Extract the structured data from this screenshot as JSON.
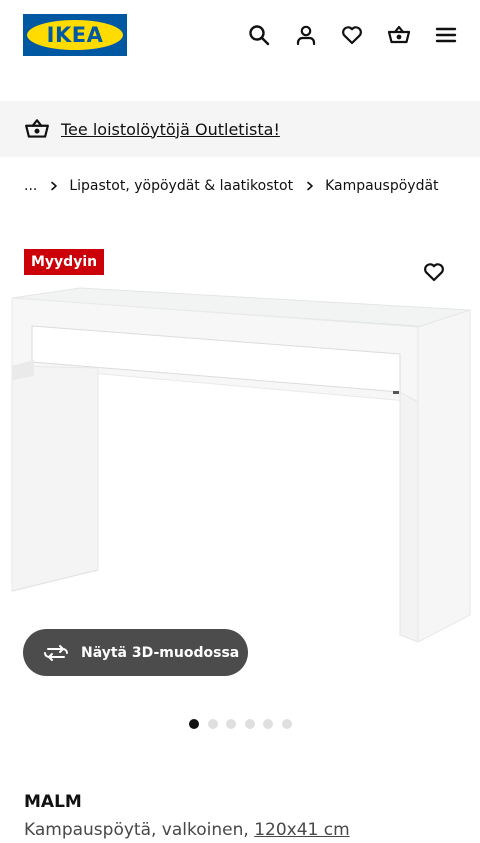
{
  "header": {
    "logo_text": "IKEA",
    "icons": [
      "search-icon",
      "account-icon",
      "heart-icon",
      "basket-icon",
      "menu-icon"
    ]
  },
  "banner": {
    "text": "Tee loistolöytöjä Outletista!",
    "icon": "outlet-basket-icon"
  },
  "breadcrumb": {
    "items": [
      "...",
      "Lipastot, yöpöydät & laatikostot",
      "Kampauspöydät"
    ]
  },
  "media": {
    "badge": "Myydyin",
    "button_3d": "Näytä 3D-muodossa",
    "dots": {
      "count": 6,
      "active_index": 0
    }
  },
  "product": {
    "name": "MALM",
    "description": "Kampauspöytä, valkoinen, ",
    "dimensions": "120x41 cm"
  },
  "colors": {
    "ikea_blue": "#0058a3",
    "ikea_yellow": "#ffdb00",
    "badge_red": "#cc0008",
    "button_dark": "#4c4c4c"
  }
}
